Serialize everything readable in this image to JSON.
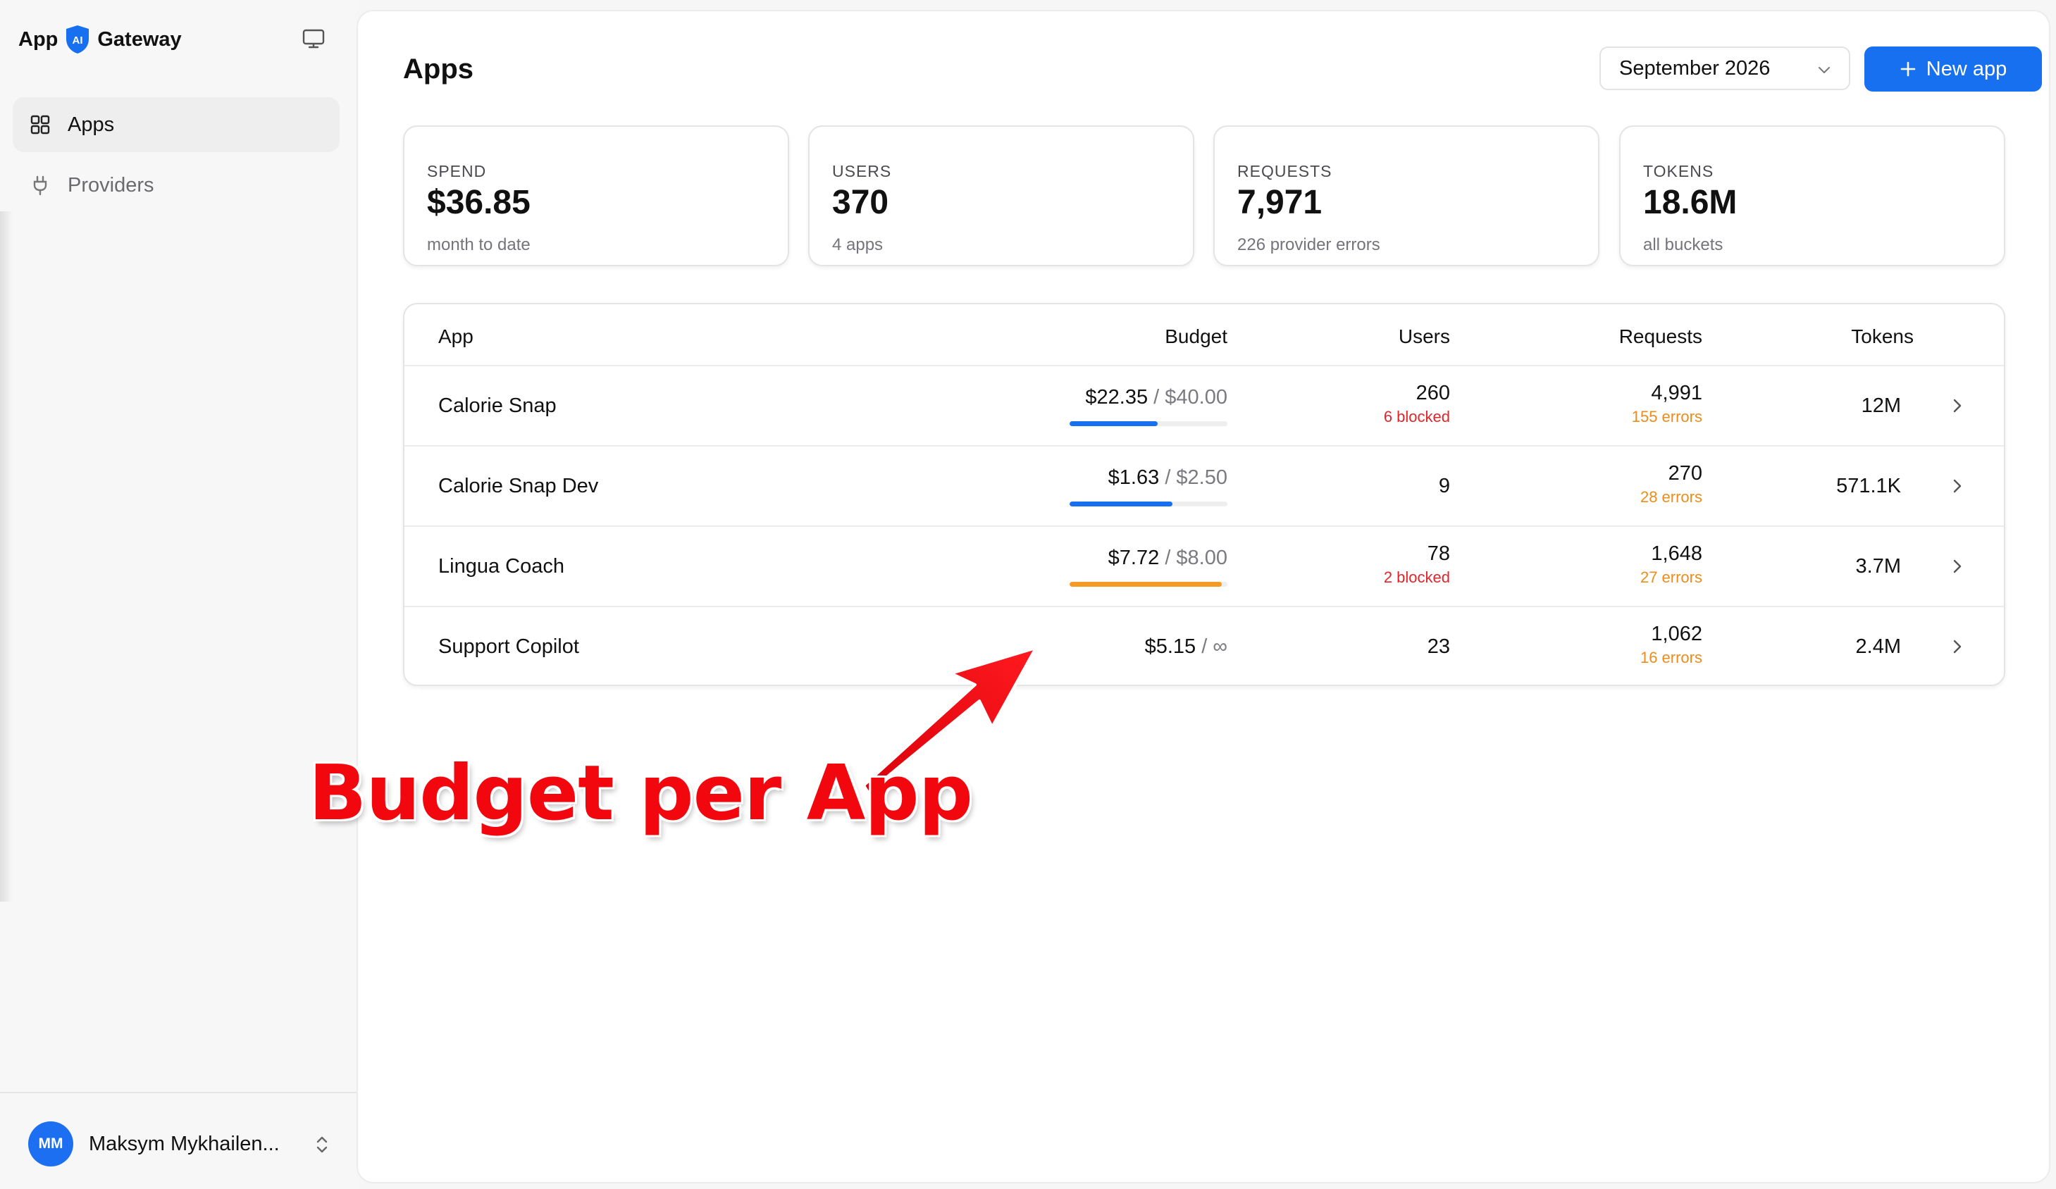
{
  "sidebar": {
    "brand_left": "App",
    "brand_badge": "AI",
    "brand_right": "Gateway",
    "nav": [
      {
        "label": "Apps",
        "icon": "grid-icon",
        "active": true
      },
      {
        "label": "Providers",
        "icon": "plug-icon",
        "active": false
      }
    ],
    "user": {
      "initials": "MM",
      "name": "Maksym Mykhailen..."
    }
  },
  "header": {
    "title": "Apps",
    "month_selected": "September 2026",
    "new_app_label": "New app"
  },
  "stats": [
    {
      "label": "SPEND",
      "value": "$36.85",
      "sub": "month to date"
    },
    {
      "label": "USERS",
      "value": "370",
      "sub": "4 apps"
    },
    {
      "label": "REQUESTS",
      "value": "7,971",
      "sub": "226 provider errors"
    },
    {
      "label": "TOKENS",
      "value": "18.6M",
      "sub": "all buckets"
    }
  ],
  "table": {
    "columns": [
      "App",
      "Budget",
      "Users",
      "Requests",
      "Tokens"
    ],
    "rows": [
      {
        "app": "Calorie Snap",
        "spent": "$22.35",
        "limit": "/ $40.00",
        "budget_fraction": 0.56,
        "bar_color": "#1670f0",
        "users": "260",
        "users_note": "6 blocked",
        "requests": "4,991",
        "requests_note": "155 errors",
        "tokens": "12M"
      },
      {
        "app": "Calorie Snap Dev",
        "spent": "$1.63",
        "limit": "/ $2.50",
        "budget_fraction": 0.65,
        "bar_color": "#1670f0",
        "users": "9",
        "users_note": "",
        "requests": "270",
        "requests_note": "28 errors",
        "tokens": "571.1K"
      },
      {
        "app": "Lingua Coach",
        "spent": "$7.72",
        "limit": "/ $8.00",
        "budget_fraction": 0.965,
        "bar_color": "#f59a23",
        "users": "78",
        "users_note": "2 blocked",
        "requests": "1,648",
        "requests_note": "27 errors",
        "tokens": "3.7M"
      },
      {
        "app": "Support Copilot",
        "spent": "$5.15",
        "limit": "/ ∞",
        "budget_fraction": null,
        "bar_color": "",
        "users": "23",
        "users_note": "",
        "requests": "1,062",
        "requests_note": "16 errors",
        "tokens": "2.4M"
      }
    ]
  },
  "colors": {
    "accent": "#1670f0",
    "blocked": "#e0262a",
    "errors": "#ee8c1a",
    "annotation": "#f2070f"
  },
  "annotation": {
    "text": "Budget per App"
  }
}
